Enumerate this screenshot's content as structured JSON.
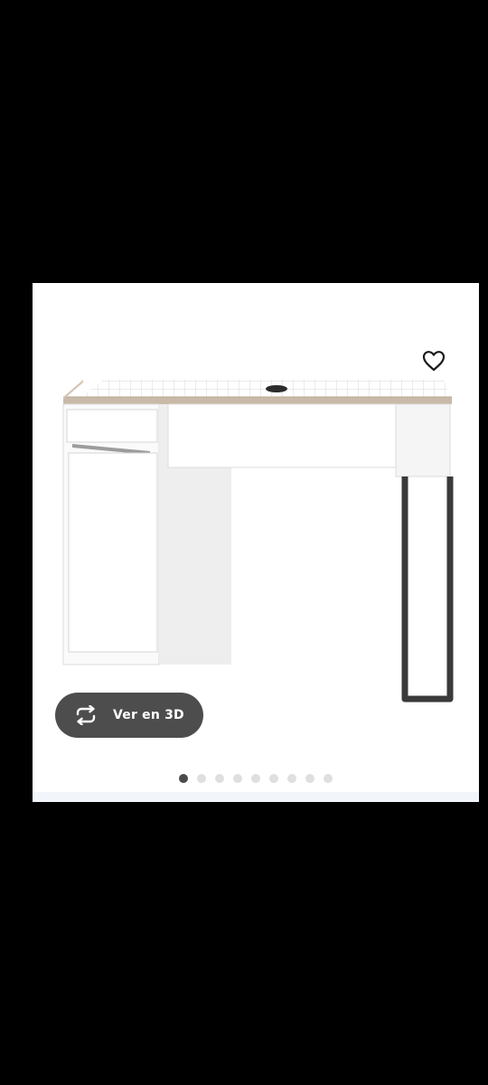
{
  "product_card": {
    "image_alt": "",
    "view_3d_label": "Ver en 3D",
    "view_3d_icon": "rotate-arrows-icon",
    "favorite_icon": "heart-outline-icon",
    "carousel": {
      "total_images": 9,
      "active_index": 0
    }
  },
  "colors": {
    "background": "#000000",
    "card": "#ffffff",
    "button": "#4d4d4d",
    "dot_active": "#4a4a4a",
    "dot_inactive": "#dfdfdf"
  }
}
